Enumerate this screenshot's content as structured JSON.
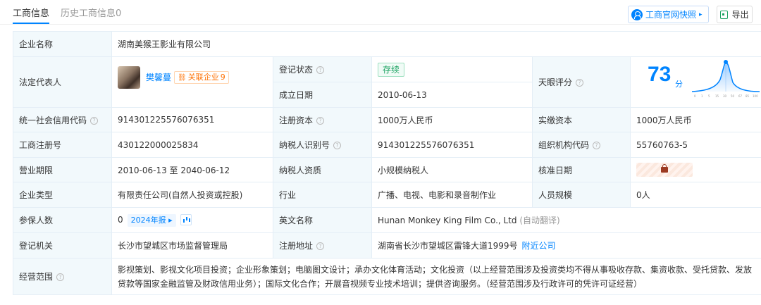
{
  "tabs": {
    "active": "工商信息",
    "history": "历史工商信息0",
    "snapshot_label": "工商官网快照",
    "snapshot_arrow": "▸",
    "export_label": "导出"
  },
  "company": {
    "name_label": "企业名称",
    "name": "湖南美猴王影业有限公司",
    "legal_rep_label": "法定代表人",
    "legal_rep_name": "樊馨蔓",
    "related_label": "关联企业",
    "related_count": "9",
    "reg_status_label": "登记状态",
    "reg_status": "存续",
    "established_label": "成立日期",
    "established": "2010-06-13",
    "score_label": "天眼评分",
    "score": "73",
    "score_unit": "分",
    "credit_code_label": "统一社会信用代码",
    "credit_code": "914301225576076351",
    "reg_capital_label": "注册资本",
    "reg_capital": "1000万人民币",
    "paid_capital_label": "实缴资本",
    "paid_capital": "1000万人民币",
    "biz_reg_no_label": "工商注册号",
    "biz_reg_no": "430122000025834",
    "taxpayer_id_label": "纳税人识别号",
    "taxpayer_id": "914301225576076351",
    "org_code_label": "组织机构代码",
    "org_code": "55760763-5",
    "biz_term_label": "营业期限",
    "biz_term": "2010-06-13 至 2040-06-12",
    "taxpayer_qual_label": "纳税人资质",
    "taxpayer_qual": "小规模纳税人",
    "approval_date_label": "核准日期",
    "company_type_label": "企业类型",
    "company_type": "有限责任公司(自然人投资或控股)",
    "industry_label": "行业",
    "industry": "广播、电视、电影和录音制作业",
    "staff_size_label": "人员规模",
    "staff_size": "0人",
    "insured_label": "参保人数",
    "insured": "0",
    "year_report": "2024年报 ▸",
    "english_name_label": "英文名称",
    "english_name": "Hunan Monkey King Film Co., Ltd",
    "auto_translate": "(自动翻译)",
    "authority_label": "登记机关",
    "authority": "长沙市望城区市场监督管理局",
    "address_label": "注册地址",
    "address": "湖南省长沙市望城区雷锋大道1999号",
    "nearby": "附近公司",
    "scope_label": "经营范围",
    "scope": "影视策划、影视文化项目投资；企业形象策划；电脑图文设计；承办文化体育活动；文化投资（以上经营范围涉及投资类均不得从事吸收存款、集资收款、受托贷款、发放贷款等国家金融监管及财政信用业务）；国际文化合作；开展音视频专业技术培训；提供咨询服务。（经营范围涉及行政许可的凭许可证经营）"
  },
  "score_chart": {
    "ticks": [
      "0",
      "1",
      "5",
      "15",
      "30",
      "50",
      "67",
      "85",
      "100"
    ]
  },
  "colors": {
    "accent": "#0084ff",
    "label_bg": "#f2f9fc",
    "status_green": "#1aa260",
    "related_orange": "#ff7000"
  }
}
